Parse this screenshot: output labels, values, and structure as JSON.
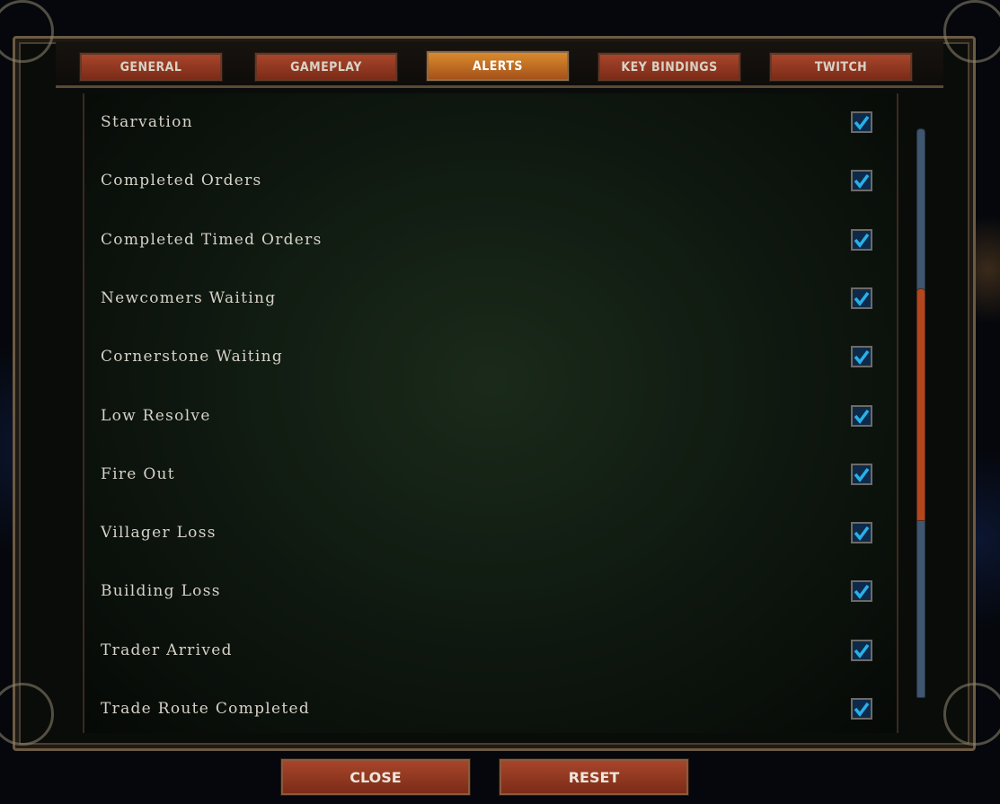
{
  "tabs": [
    {
      "label": "GENERAL",
      "active": false
    },
    {
      "label": "GAMEPLAY",
      "active": false
    },
    {
      "label": "ALERTS",
      "active": true
    },
    {
      "label": "KEY BINDINGS",
      "active": false
    },
    {
      "label": "TWITCH",
      "active": false
    }
  ],
  "alerts": [
    {
      "label": "Starvation",
      "checked": true
    },
    {
      "label": "Completed Orders",
      "checked": true
    },
    {
      "label": "Completed Timed Orders",
      "checked": true
    },
    {
      "label": "Newcomers Waiting",
      "checked": true
    },
    {
      "label": "Cornerstone Waiting",
      "checked": true
    },
    {
      "label": "Low Resolve",
      "checked": true
    },
    {
      "label": "Fire Out",
      "checked": true
    },
    {
      "label": "Villager Loss",
      "checked": true
    },
    {
      "label": "Building Loss",
      "checked": true
    },
    {
      "label": "Trader Arrived",
      "checked": true
    },
    {
      "label": "Trade Route Completed",
      "checked": true
    }
  ],
  "scrollbar": {
    "thumb_start_fraction": 0.28,
    "thumb_size_fraction": 0.41
  },
  "buttons": {
    "close": "CLOSE",
    "reset": "RESET"
  },
  "colors": {
    "accent_tab": "#d98a2c",
    "button": "#9a3d24",
    "checkbox": "#2ab0e8",
    "scroll_thumb": "#b4461e"
  }
}
